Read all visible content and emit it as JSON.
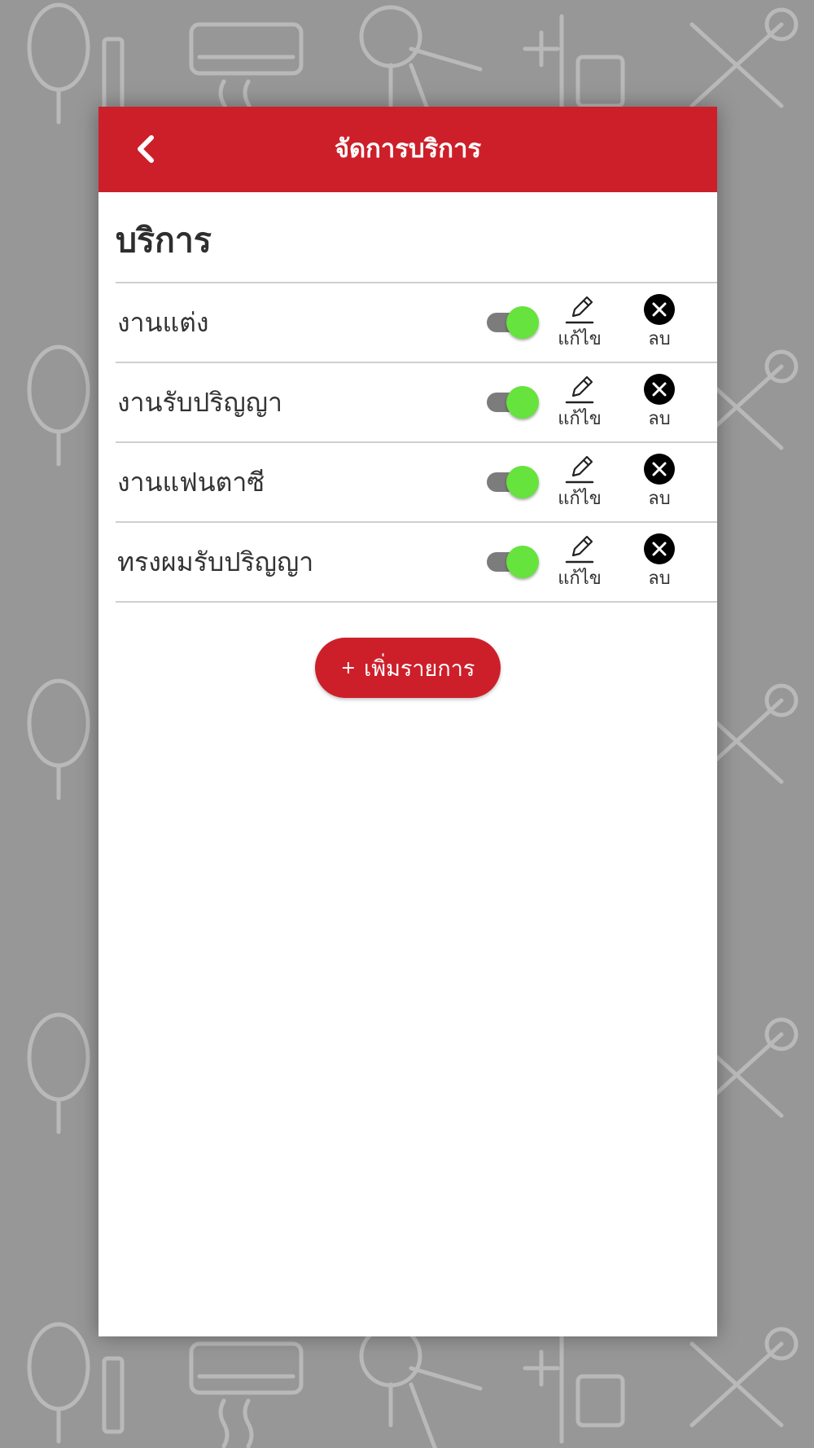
{
  "header": {
    "title": "จัดการบริการ",
    "back_icon": "chevron-left-icon",
    "color": "#cd1f2a"
  },
  "section": {
    "title": "บริการ"
  },
  "services": [
    {
      "name": "งานแต่ง",
      "enabled": true,
      "edit_label": "แก้ไข",
      "delete_label": "ลบ"
    },
    {
      "name": "งานรับปริญญา",
      "enabled": true,
      "edit_label": "แก้ไข",
      "delete_label": "ลบ"
    },
    {
      "name": "งานแฟนตาซี",
      "enabled": true,
      "edit_label": "แก้ไข",
      "delete_label": "ลบ"
    },
    {
      "name": "ทรงผมรับปริญญา",
      "enabled": true,
      "edit_label": "แก้ไข",
      "delete_label": "ลบ"
    }
  ],
  "add_button": {
    "icon": "+",
    "label": "เพิ่มรายการ"
  },
  "colors": {
    "accent": "#cd1f2a",
    "toggle_on": "#66e33c",
    "toggle_track": "#7c7c7c",
    "background": "#979797"
  }
}
